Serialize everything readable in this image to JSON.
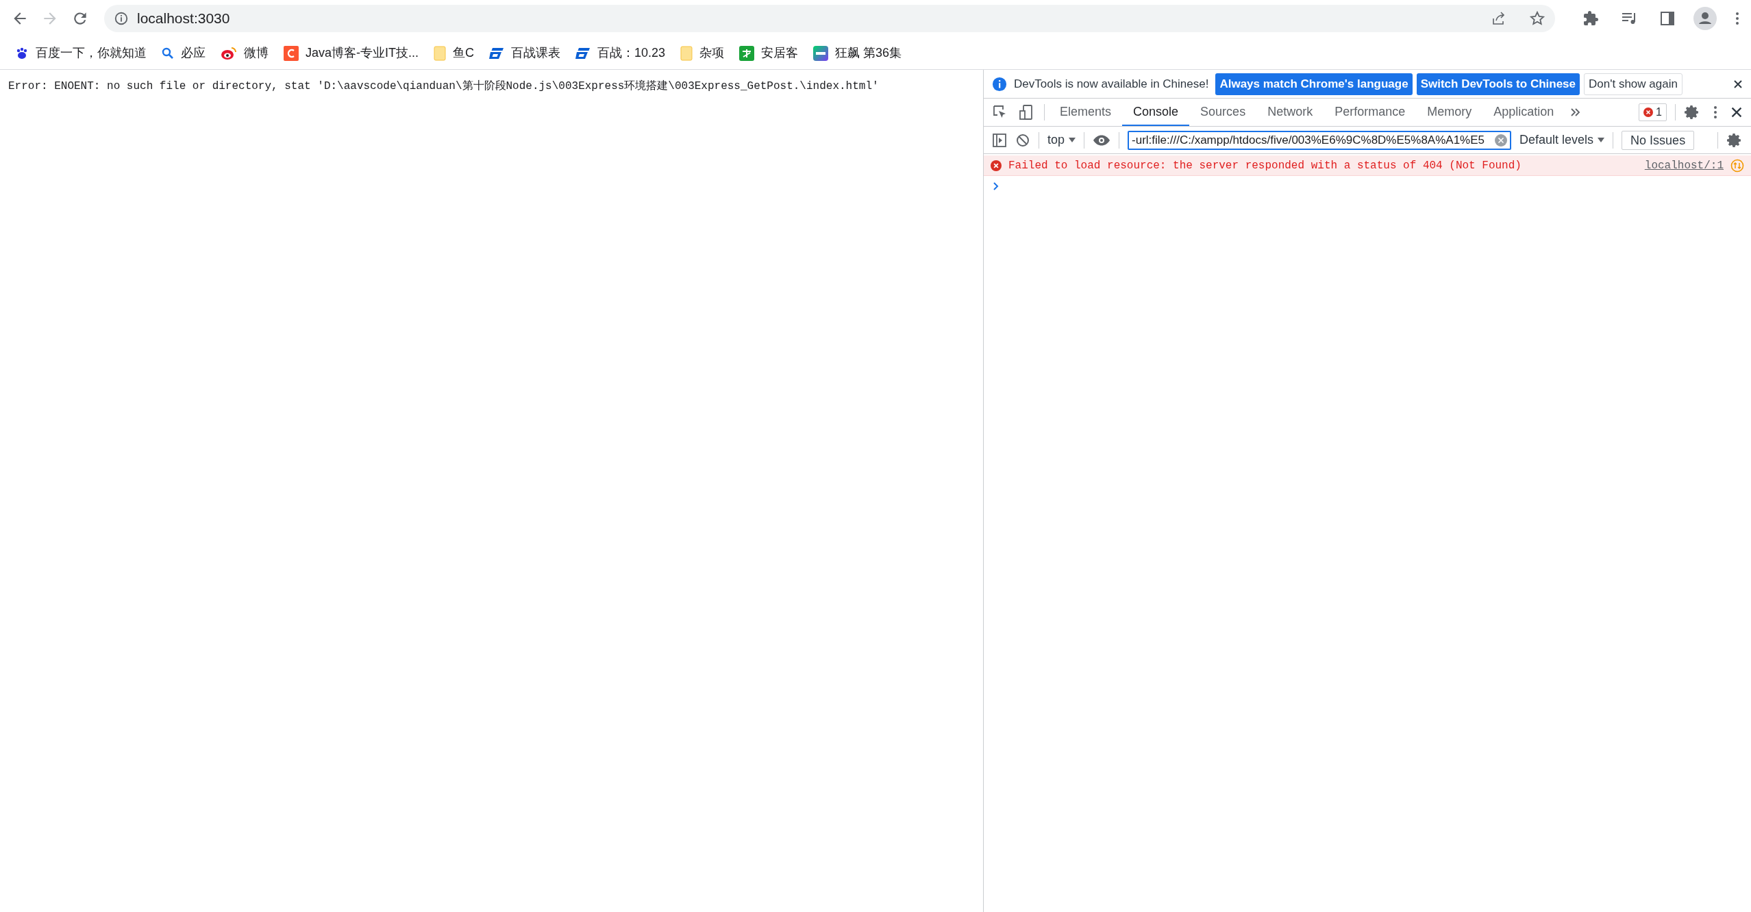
{
  "address_bar": {
    "url": "localhost:3030"
  },
  "bookmarks": [
    {
      "label": "百度一下，你就知道",
      "kind": "paw"
    },
    {
      "label": "必应",
      "kind": "search"
    },
    {
      "label": "微博",
      "kind": "eye"
    },
    {
      "label": "Java博客-专业IT技...",
      "kind": "square"
    },
    {
      "label": "鱼C",
      "kind": "folder"
    },
    {
      "label": "百战课表",
      "kind": "logo"
    },
    {
      "label": "百战：10.23",
      "kind": "logo"
    },
    {
      "label": "杂项",
      "kind": "folder"
    },
    {
      "label": "安居客",
      "kind": "greensquare"
    },
    {
      "label": "狂飙 第36集",
      "kind": "gradient"
    }
  ],
  "page": {
    "error_text": "Error: ENOENT: no such file or directory, stat 'D:\\aavscode\\qianduan\\第十阶段Node.js\\003Express环境搭建\\003Express_GetPost.\\index.html'"
  },
  "devtools": {
    "infobar": {
      "message": "DevTools is now available in Chinese!",
      "buttons": [
        {
          "label": "Always match Chrome's language",
          "primary": true
        },
        {
          "label": "Switch DevTools to Chinese",
          "primary": true
        },
        {
          "label": "Don't show again",
          "primary": false
        }
      ]
    },
    "tabs": [
      {
        "label": "Elements",
        "selected": false
      },
      {
        "label": "Console",
        "selected": true
      },
      {
        "label": "Sources",
        "selected": false
      },
      {
        "label": "Network",
        "selected": false
      },
      {
        "label": "Performance",
        "selected": false
      },
      {
        "label": "Memory",
        "selected": false
      },
      {
        "label": "Application",
        "selected": false
      }
    ],
    "error_count": "1",
    "context": "top",
    "filter": {
      "value": "-url:file:///C:/xampp/htdocs/five/003%E6%9C%8D%E5%8A%A1%E5"
    },
    "levels": "Default levels",
    "issues": "No Issues",
    "messages": [
      {
        "text": "Failed to load resource: the server responded with a status of 404 (Not Found)",
        "source": "localhost/:1"
      }
    ]
  }
}
